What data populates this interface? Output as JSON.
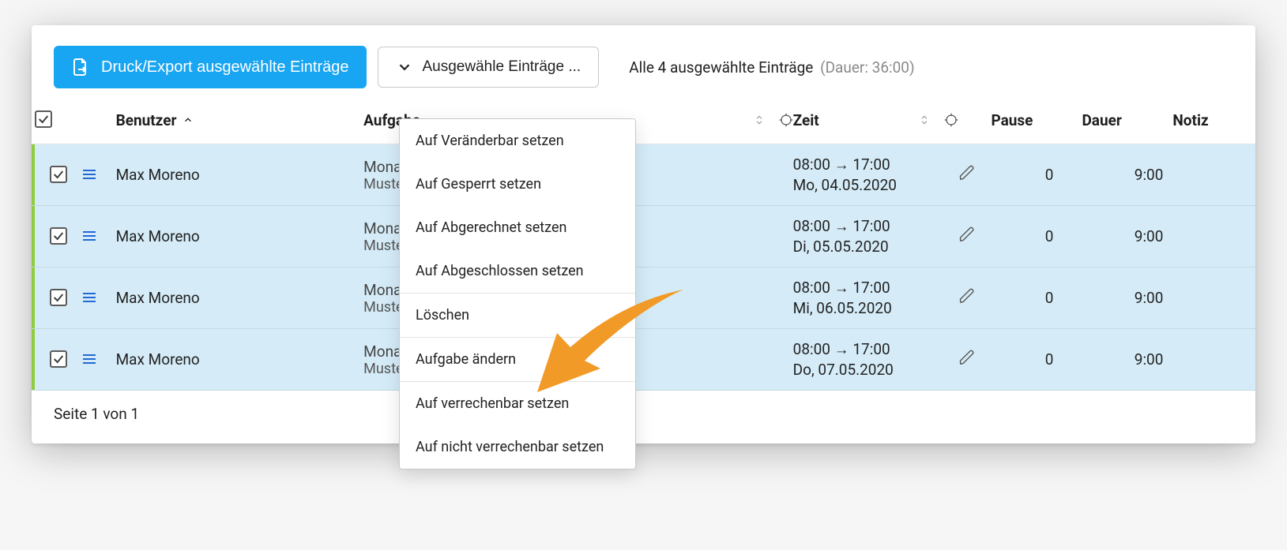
{
  "toolbar": {
    "export_label": "Druck/Export ausgewählte Einträge",
    "dropdown_label": "Ausgewähle Einträge ..."
  },
  "summary": {
    "text": "Alle 4 ausgewählte Einträge",
    "duration": "(Dauer: 36:00)"
  },
  "columns": {
    "user": "Benutzer",
    "task": "Aufgabe",
    "time": "Zeit",
    "pause": "Pause",
    "duration": "Dauer",
    "note": "Notiz"
  },
  "rows": [
    {
      "user": "Max Moreno",
      "task": "Monatliche Wartung",
      "taskSub": "Muster Maria",
      "time": "08:00 → 17:00",
      "date": "Mo, 04.05.2020",
      "pause": "0",
      "duration": "9:00"
    },
    {
      "user": "Max Moreno",
      "task": "Monatliche Wartung",
      "taskSub": "Muster Maria",
      "time": "08:00 → 17:00",
      "date": "Di, 05.05.2020",
      "pause": "0",
      "duration": "9:00"
    },
    {
      "user": "Max Moreno",
      "task": "Monatliche Wartung",
      "taskSub": "Muster Maria",
      "time": "08:00 → 17:00",
      "date": "Mi, 06.05.2020",
      "pause": "0",
      "duration": "9:00"
    },
    {
      "user": "Max Moreno",
      "task": "Monatliche Wartung",
      "taskSub": "Muster Maria",
      "time": "08:00 → 17:00",
      "date": "Do, 07.05.2020",
      "pause": "0",
      "duration": "9:00"
    }
  ],
  "menu": {
    "set_editable": "Auf Veränderbar setzen",
    "set_locked": "Auf Gesperrt setzen",
    "set_billed": "Auf Abgerechnet setzen",
    "set_completed": "Auf Abgeschlossen setzen",
    "delete": "Löschen",
    "change_task": "Aufgabe ändern",
    "set_billable": "Auf verrechenbar setzen",
    "set_nonbillable": "Auf nicht verrechenbar setzen"
  },
  "footer": {
    "page": "Seite 1 von 1"
  }
}
